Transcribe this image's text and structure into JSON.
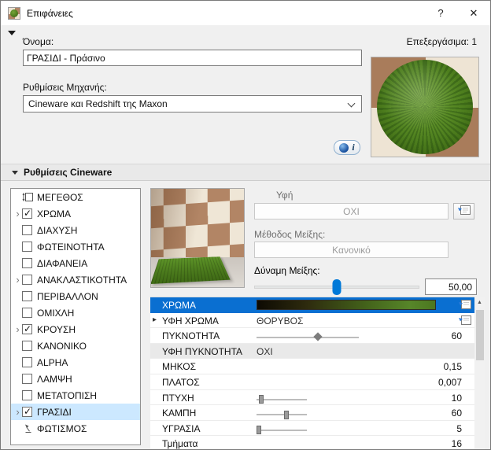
{
  "window": {
    "title": "Επιφάνειες",
    "help": "?",
    "close": "✕"
  },
  "header": {
    "name_label": "Όνομα:",
    "name_value": "ΓΡΑΣΙΔΙ - Πράσινο",
    "editable": "Επεξεργάσιμα: 1",
    "engine_label": "Ρυθμίσεις Μηχανής:",
    "engine_value": "Cineware και Redshift της Maxon",
    "info_label": "i"
  },
  "section": {
    "title": "Ρυθμίσεις Cineware"
  },
  "channels": {
    "items": [
      {
        "label": "ΜΕΓΕΘΟΣ",
        "icon": "size-icon",
        "expand": false,
        "checked": false,
        "selected": false
      },
      {
        "label": "ΧΡΩΜΑ",
        "expand": true,
        "checked": true,
        "selected": false
      },
      {
        "label": "ΔΙΑΧΥΣΗ",
        "expand": false,
        "checked": false,
        "selected": false
      },
      {
        "label": "ΦΩΤΕΙΝΟΤΗΤΑ",
        "expand": false,
        "checked": false,
        "selected": false
      },
      {
        "label": "ΔΙΑΦΑΝΕΙΑ",
        "expand": false,
        "checked": false,
        "selected": false
      },
      {
        "label": "ΑΝΑΚΛΑΣΤΙΚΟΤΗΤΑ",
        "expand": true,
        "checked": false,
        "selected": false
      },
      {
        "label": "ΠΕΡΙΒΑΛΛΟΝ",
        "expand": false,
        "checked": false,
        "selected": false
      },
      {
        "label": "ΟΜΙΧΛΗ",
        "expand": false,
        "checked": false,
        "selected": false
      },
      {
        "label": "ΚΡΟΥΣΗ",
        "expand": true,
        "checked": true,
        "selected": false
      },
      {
        "label": "ΚΑΝΟΝΙΚΟ",
        "expand": false,
        "checked": false,
        "selected": false
      },
      {
        "label": "ALPHA",
        "expand": false,
        "checked": false,
        "selected": false
      },
      {
        "label": "ΛΑΜΨΗ",
        "expand": false,
        "checked": false,
        "selected": false
      },
      {
        "label": "ΜΕΤΑΤΟΠΙΣΗ",
        "expand": false,
        "checked": false,
        "selected": false
      },
      {
        "label": "ΓΡΑΣΙΔΙ",
        "expand": true,
        "checked": true,
        "selected": true
      },
      {
        "label": "ΦΩΤΙΣΜΟΣ",
        "icon": "lamp-icon",
        "expand": false,
        "checked": false,
        "selected": false
      }
    ]
  },
  "detail": {
    "texture_label": "Υφή",
    "texture_value": "ΟΧΙ",
    "mix_method_label": "Μέθοδος Μείξης:",
    "mix_method_value": "Κανονικό",
    "mix_strength_label": "Δύναμη Μείξης:",
    "mix_strength_value": "50,00",
    "mix_strength_percent": 50
  },
  "params": {
    "rows": [
      {
        "label": "ΧΡΩΜΑ",
        "type": "gradient",
        "selected": true
      },
      {
        "label": "ΥΦΗ ΧΡΩΜΑ",
        "value": "ΘΟΡΥΒΟΣ",
        "expand": true
      },
      {
        "label": "ΠΥΚΝΟΤΗΤΑ",
        "value": "60",
        "slider": 60
      },
      {
        "label": "ΥΦΗ ΠΥΚΝΟΤΗΤΑ",
        "value": "ΟΧΙ",
        "shaded": true
      },
      {
        "label": "ΜΗΚΟΣ",
        "value": "0,15"
      },
      {
        "label": "ΠΛΑΤΟΣ",
        "value": "0,007"
      },
      {
        "label": "ΠΤΥΧΗ",
        "value": "10",
        "slider": 10
      },
      {
        "label": "ΚΑΜΠΗ",
        "value": "60",
        "slider": 60
      },
      {
        "label": "ΥΓΡΑΣΙΑ",
        "value": "5",
        "slider": 5
      },
      {
        "label": "Τμήματα",
        "value": "16"
      }
    ]
  },
  "colors": {
    "selection": "#0a6fd1",
    "selected_item_bg": "#cce8ff",
    "accent_blue": "#2f7bd9",
    "grass_green": "#4e7f1e",
    "tile_brown": "#b28565",
    "tile_cream": "#eee4d4"
  }
}
